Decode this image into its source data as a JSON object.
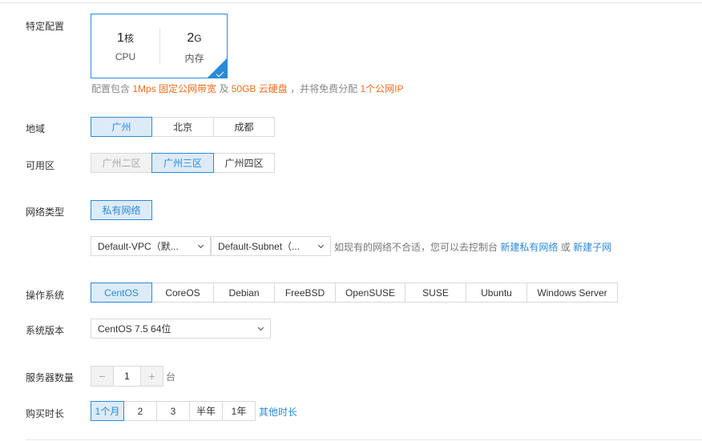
{
  "spec": {
    "label": "特定配置",
    "cpu_value": "1",
    "cpu_unit": "核",
    "cpu_label": "CPU",
    "mem_value": "2",
    "mem_unit": "G",
    "mem_label": "内存",
    "note_prefix": "配置包含",
    "bandwidth": "1Mps 固定公网带宽",
    "and": "及",
    "disk": "50GB 云硬盘",
    "note_middle": "，并将免费分配",
    "ip": "1个公网IP"
  },
  "region": {
    "label": "地域",
    "options": [
      "广州",
      "北京",
      "成都"
    ],
    "selected": "广州"
  },
  "zone": {
    "label": "可用区",
    "options": [
      "广州二区",
      "广州三区",
      "广州四区"
    ],
    "selected": "广州三区",
    "disabled": [
      "广州二区"
    ]
  },
  "network": {
    "label": "网络类型",
    "type_option": "私有网络",
    "vpc_value": "Default-VPC（默...",
    "subnet_value": "Default-Subnet（...",
    "hint_text": "如现有的网络不合适，您可以去控制台",
    "new_vpc_link": "新建私有网络",
    "or": "或",
    "new_subnet_link": "新建子网"
  },
  "os": {
    "label": "操作系统",
    "options": [
      "CentOS",
      "CoreOS",
      "Debian",
      "FreeBSD",
      "OpenSUSE",
      "SUSE",
      "Ubuntu",
      "Windows Server"
    ],
    "selected": "CentOS"
  },
  "os_version": {
    "label": "系统版本",
    "value": "CentOS 7.5 64位"
  },
  "quantity": {
    "label": "服务器数量",
    "minus": "−",
    "value": "1",
    "plus": "+",
    "unit": "台"
  },
  "duration": {
    "label": "购买时长",
    "options": [
      "1个月",
      "2",
      "3",
      "半年",
      "1年"
    ],
    "selected": "1个月",
    "other_link": "其他时长"
  },
  "colors": {
    "accent": "#2b8ad8",
    "highlight": "#f26b1d",
    "selected_bg": "#ddebf8"
  }
}
